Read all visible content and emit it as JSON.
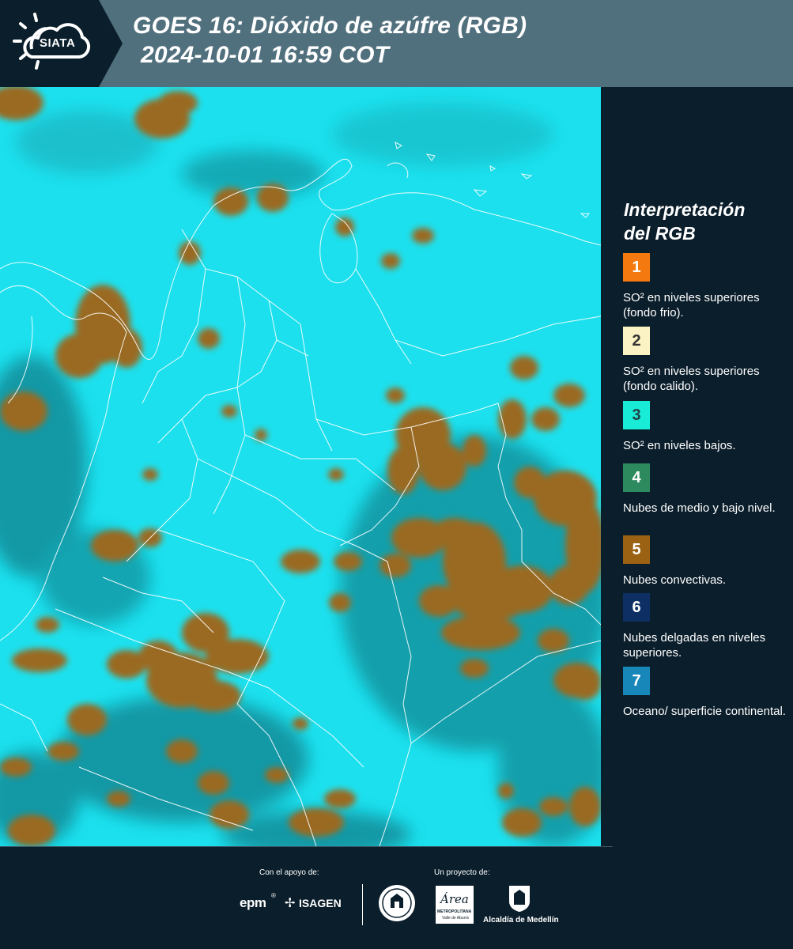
{
  "header": {
    "logo_text": "SIATA",
    "title_line1": "GOES 16: Dióxido de azúfre (RGB)",
    "title_line2": "2024-10-01 16:59 COT"
  },
  "legend": {
    "title_line1": "Interpretación",
    "title_line2": "del RGB",
    "items": [
      {
        "num": "1",
        "label": "SO² en niveles superiores (fondo frio).",
        "color": "#f47a10",
        "text_color": "#ffffff"
      },
      {
        "num": "2",
        "label": "SO² en niveles superiores (fondo calido).",
        "color": "#fbf3c4",
        "text_color": "#333333"
      },
      {
        "num": "3",
        "label": "SO² en niveles bajos.",
        "color": "#19ecd6",
        "text_color": "#234046"
      },
      {
        "num": "4",
        "label": "Nubes de medio y bajo nivel.",
        "color": "#2d8a5e",
        "text_color": "#ffffff"
      },
      {
        "num": "5",
        "label": "Nubes convectivas.",
        "color": "#9a6212",
        "text_color": "#ffffff"
      },
      {
        "num": "6",
        "label": "Nubes delgadas en niveles superiores.",
        "color": "#0d2f64",
        "text_color": "#ffffff"
      },
      {
        "num": "7",
        "label": "Oceano/ superficie continental.",
        "color": "#1787b9",
        "text_color": "#ffffff"
      }
    ]
  },
  "footer": {
    "support_label": "Con el apoyo de:",
    "project_label": "Un proyecto de:",
    "sponsor1": "epm",
    "sponsor2": "ISAGEN",
    "partner1_line1": "METROPOLITANA",
    "partner1_line2": "Valle de Aburrá",
    "partner1_script": "Área",
    "partner2": "Alcaldía de Medellín"
  },
  "colors": {
    "header_bg": "#51707d",
    "panel_bg": "#0b1e2b",
    "map_background": "#1ce0ee",
    "convective_cloud": "#9a6a22"
  }
}
